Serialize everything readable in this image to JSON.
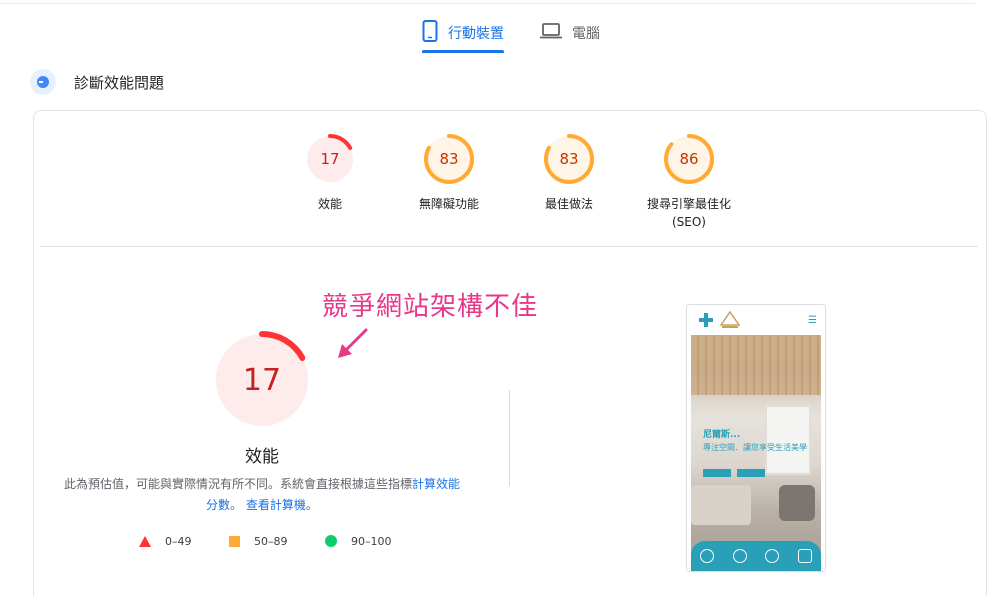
{
  "tabs": {
    "mobile_label": "行動裝置",
    "desktop_label": "電腦"
  },
  "diagnose": {
    "title": "診斷效能問題"
  },
  "scores": [
    {
      "value": 17,
      "label": "效能",
      "sub": "",
      "color": "#ff3333",
      "bg": "#fdeceb"
    },
    {
      "value": 83,
      "label": "無障礙功能",
      "sub": "",
      "color": "#ffaa33",
      "bg": "#fff5e6"
    },
    {
      "value": 83,
      "label": "最佳做法",
      "sub": "",
      "color": "#ffaa33",
      "bg": "#fff5e6"
    },
    {
      "value": 86,
      "label": "搜尋引擎最佳化",
      "sub": "(SEO)",
      "color": "#ffaa33",
      "bg": "#fff5e6"
    }
  ],
  "annotation": "競爭網站架構不佳",
  "main_score": {
    "value": 17,
    "label": "效能",
    "color": "#ff3333",
    "bg": "#fdeceb"
  },
  "description": {
    "text1": "此為預估值，可能與實際情況有所不同。系統會直接根據這些指標",
    "link1": "計算效能分數",
    "text2": "。",
    "link2": "查看計算機",
    "text3": "。"
  },
  "legend": [
    {
      "range": "0–49",
      "shape": "triangle",
      "color": "#ff3333"
    },
    {
      "range": "50–89",
      "shape": "square",
      "color": "#ffaa33"
    },
    {
      "range": "90–100",
      "shape": "circle",
      "color": "#0cce6b"
    }
  ],
  "preview": {
    "site_title": "尼爾斯...",
    "site_sub": "專注空間．讓您享受生活美學"
  }
}
